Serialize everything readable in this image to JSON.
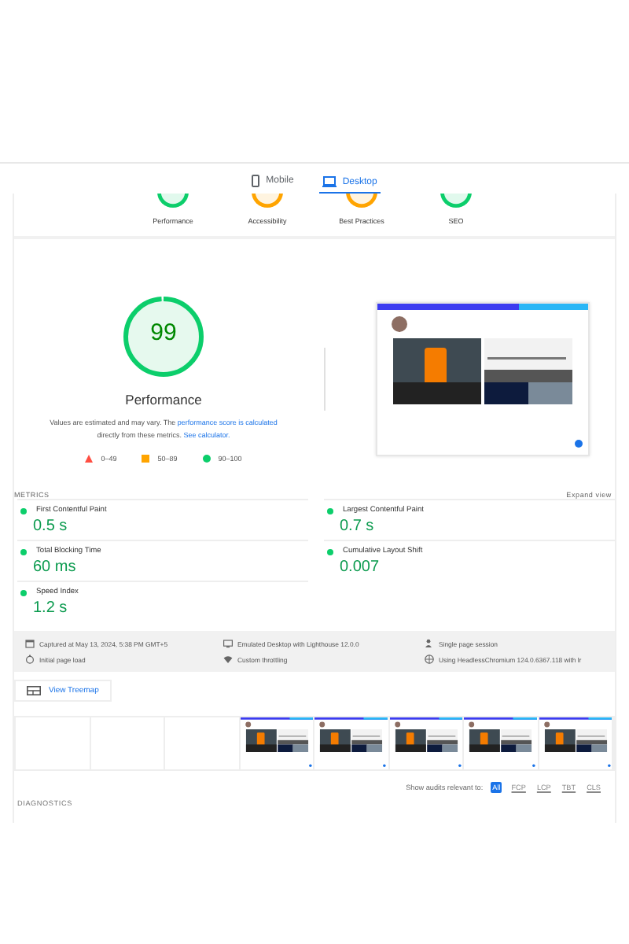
{
  "tabs": [
    {
      "label": "Mobile",
      "kind": "mobile",
      "selected": false
    },
    {
      "label": "Desktop",
      "kind": "desktop",
      "selected": true
    }
  ],
  "categories": [
    {
      "label": "Performance",
      "color": "#0cce6b"
    },
    {
      "label": "Accessibility",
      "color": "#ffa400"
    },
    {
      "label": "Best Practices",
      "color": "#ffa400"
    },
    {
      "label": "SEO",
      "color": "#0cce6b"
    }
  ],
  "gauge": {
    "score": "99",
    "title": "Performance",
    "level": 0.99,
    "color": "#0cce6b"
  },
  "note": {
    "text": "Values are estimated and may vary. The ",
    "link1": "performance score is calculated",
    "mid": " directly from these metrics. ",
    "link2": "See calculator."
  },
  "legend": [
    {
      "kind": "fail",
      "label": "0–49"
    },
    {
      "kind": "average",
      "label": "50–89"
    },
    {
      "kind": "pass",
      "label": "90–100"
    }
  ],
  "metrics_heading": "METRICS",
  "expand": "Expand view",
  "metrics": [
    {
      "name": "First Contentful Paint",
      "value": "0.5 s",
      "color": "#0cce6b"
    },
    {
      "name": "Largest Contentful Paint",
      "value": "0.7 s",
      "color": "#0cce6b"
    },
    {
      "name": "Total Blocking Time",
      "value": "60 ms",
      "color": "#0cce6b"
    },
    {
      "name": "Cumulative Layout Shift",
      "value": "0.007",
      "color": "#0cce6b"
    },
    {
      "name": "Speed Index",
      "value": "1.2 s",
      "color": "#0cce6b"
    }
  ],
  "info": [
    {
      "kind": "calendar",
      "text": "Captured at May 13, 2024, 5:38 PM GMT+5"
    },
    {
      "kind": "device",
      "text": "Emulated Desktop with Lighthouse 12.0.0"
    },
    {
      "kind": "person",
      "text": "Single page session"
    },
    {
      "kind": "timer",
      "text": "Initial page load"
    },
    {
      "kind": "wifi",
      "text": "Custom throttling"
    },
    {
      "kind": "globe",
      "text": "Using HeadlessChromium 124.0.6367.118 with lr"
    }
  ],
  "treemap": "View Treemap",
  "filmstrip": [
    {
      "kind": "blank"
    },
    {
      "kind": "blank"
    },
    {
      "kind": "blank"
    },
    {
      "kind": "picture"
    },
    {
      "kind": "picture"
    },
    {
      "kind": "picture"
    },
    {
      "kind": "picture"
    },
    {
      "kind": "picture"
    }
  ],
  "filter": {
    "label": "Show audits relevant to:",
    "options": [
      {
        "label": "All",
        "selected": true
      },
      {
        "label": "FCP",
        "selected": false
      },
      {
        "label": "LCP",
        "selected": false
      },
      {
        "label": "TBT",
        "selected": false
      },
      {
        "label": "CLS",
        "selected": false
      }
    ]
  },
  "diagnostics": "DIAGNOSTICS"
}
